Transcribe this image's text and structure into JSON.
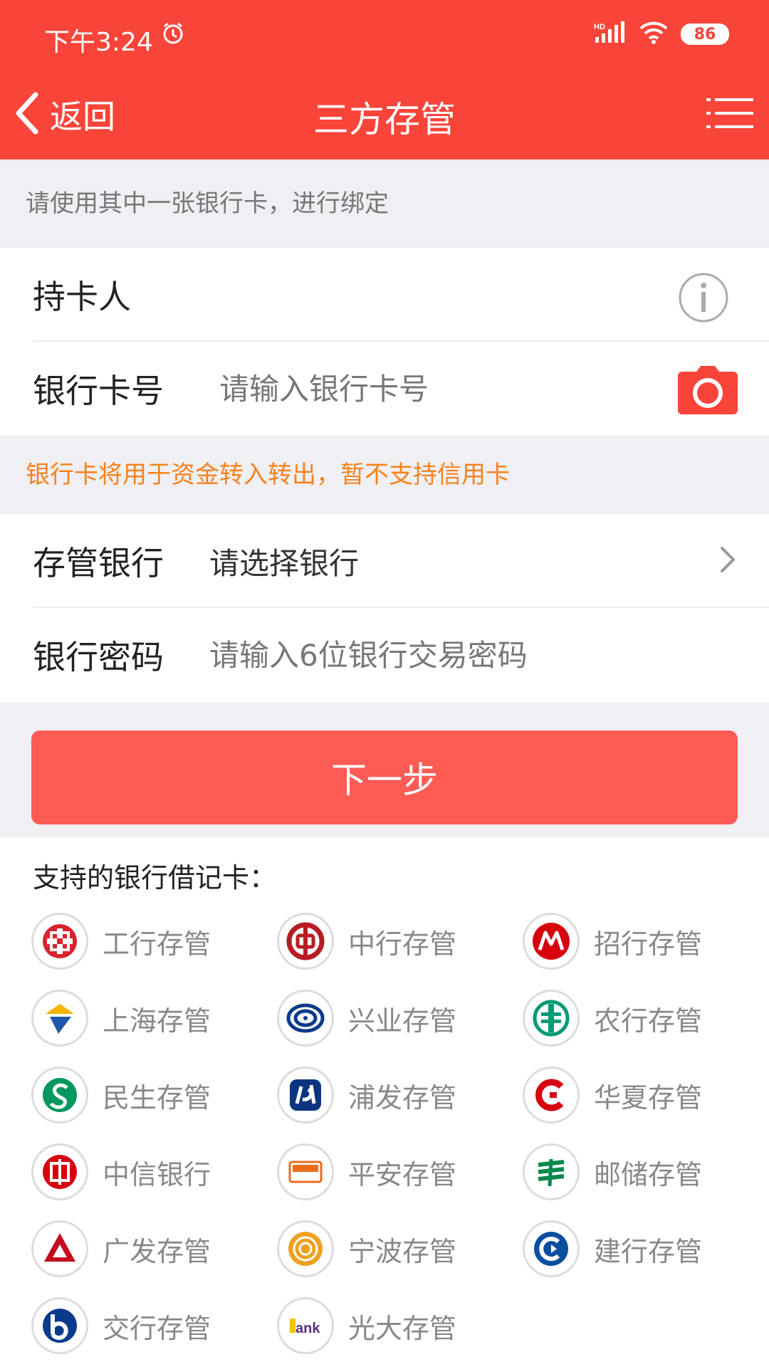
{
  "status_bar": {
    "time": "下午3:24",
    "network": "HD",
    "battery": "86"
  },
  "nav": {
    "back_label": "返回",
    "title": "三方存管"
  },
  "hint": "请使用其中一张银行卡，进行绑定",
  "form1": {
    "holder_label": "持卡人",
    "card_label": "银行卡号",
    "card_placeholder": "请输入银行卡号"
  },
  "warning": "银行卡将用于资金转入转出，暂不支持信用卡",
  "form2": {
    "bank_label": "存管银行",
    "bank_value": "请选择银行",
    "password_label": "银行密码",
    "password_placeholder": "请输入6位银行交易密码"
  },
  "next_button": "下一步",
  "banks": {
    "heading": "支持的银行借记卡：",
    "items": [
      {
        "name": "工行存管",
        "icon": "icbc-logo-icon",
        "color": "#d9232d"
      },
      {
        "name": "中行存管",
        "icon": "boc-logo-icon",
        "color": "#b81c22"
      },
      {
        "name": "招行存管",
        "icon": "cmb-logo-icon",
        "color": "#d7000f"
      },
      {
        "name": "上海存管",
        "icon": "bosc-logo-icon",
        "color": "#1f58a8"
      },
      {
        "name": "兴业存管",
        "icon": "cib-logo-icon",
        "color": "#0a3a8c"
      },
      {
        "name": "农行存管",
        "icon": "abc-logo-icon",
        "color": "#009a74"
      },
      {
        "name": "民生存管",
        "icon": "cmbc-logo-icon",
        "color": "#00985f"
      },
      {
        "name": "浦发存管",
        "icon": "spdb-logo-icon",
        "color": "#0a3480"
      },
      {
        "name": "华夏存管",
        "icon": "hxb-logo-icon",
        "color": "#d7000f"
      },
      {
        "name": "中信银行",
        "icon": "citic-logo-icon",
        "color": "#d7000f"
      },
      {
        "name": "平安存管",
        "icon": "pingan-logo-icon",
        "color": "#ec6b1c"
      },
      {
        "name": "邮储存管",
        "icon": "psbc-logo-icon",
        "color": "#00884b"
      },
      {
        "name": "广发存管",
        "icon": "cgb-logo-icon",
        "color": "#c40c1f"
      },
      {
        "name": "宁波存管",
        "icon": "nbcb-logo-icon",
        "color": "#f0a020"
      },
      {
        "name": "建行存管",
        "icon": "ccb-logo-icon",
        "color": "#0a4ea0"
      },
      {
        "name": "交行存管",
        "icon": "bocom-logo-icon",
        "color": "#0a3a8c"
      },
      {
        "name": "光大存管",
        "icon": "ceb-logo-icon",
        "color": "#5a2d82"
      }
    ]
  },
  "colors": {
    "primary": "#f9443a",
    "button": "#fd5b54",
    "warning": "#f7821b"
  }
}
